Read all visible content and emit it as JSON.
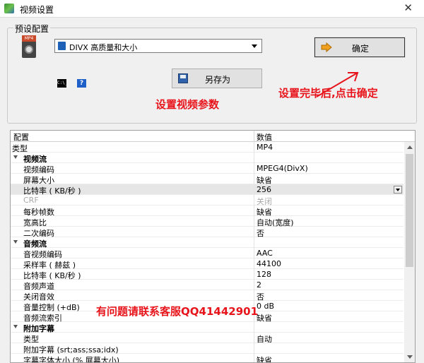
{
  "window": {
    "title": "视频设置"
  },
  "preset": {
    "group_label": "预设配置",
    "file_icon_tag": "MP4",
    "selected_value": "DIVX 高质量和大小",
    "ok_label": "确定",
    "save_as_label": "另存为",
    "cmd_icon_text": "C:\\_"
  },
  "annotations": {
    "settings_title": "设置视频参数",
    "confirm_hint": "设置完毕后,点击确定",
    "contact": "有问题请联系客服QQ41442901",
    "color": "#e8141b"
  },
  "grid": {
    "headers": {
      "name": "配置",
      "value": "数值"
    },
    "rows": [
      {
        "name": "类型",
        "value": "MP4"
      },
      {
        "category": true,
        "name": "视频流",
        "value": ""
      },
      {
        "name": "视频编码",
        "value": "MPEG4(DivX)"
      },
      {
        "name": "屏幕大小",
        "value": "缺省"
      },
      {
        "name": "比特率 ( KB/秒 )",
        "value": "256",
        "selected": true,
        "dropdown": true
      },
      {
        "name": "CRF",
        "value": "关闭",
        "disabled": true
      },
      {
        "name": "每秒帧数",
        "value": "缺省"
      },
      {
        "name": "宽高比",
        "value": "自动(宽度)"
      },
      {
        "name": "二次编码",
        "value": "否"
      },
      {
        "category": true,
        "name": "音频流",
        "value": ""
      },
      {
        "name": "音视频编码",
        "value": "AAC"
      },
      {
        "name": "采样率 ( 赫兹 )",
        "value": "44100"
      },
      {
        "name": "比特率 ( KB/秒 )",
        "value": "128"
      },
      {
        "name": "音频声道",
        "value": "2"
      },
      {
        "name": "关闭音效",
        "value": "否"
      },
      {
        "name": "音量控制 (+dB)",
        "value": "0 dB"
      },
      {
        "name": "音频流索引",
        "value": "缺省"
      },
      {
        "category": true,
        "name": "附加字幕",
        "value": ""
      },
      {
        "name": "类型",
        "value": "自动"
      },
      {
        "name": "附加字幕 (srt;ass;ssa;idx)",
        "value": ""
      },
      {
        "name": "字幕字体大小 (% 屏幕大小)",
        "value": "缺省"
      }
    ]
  }
}
